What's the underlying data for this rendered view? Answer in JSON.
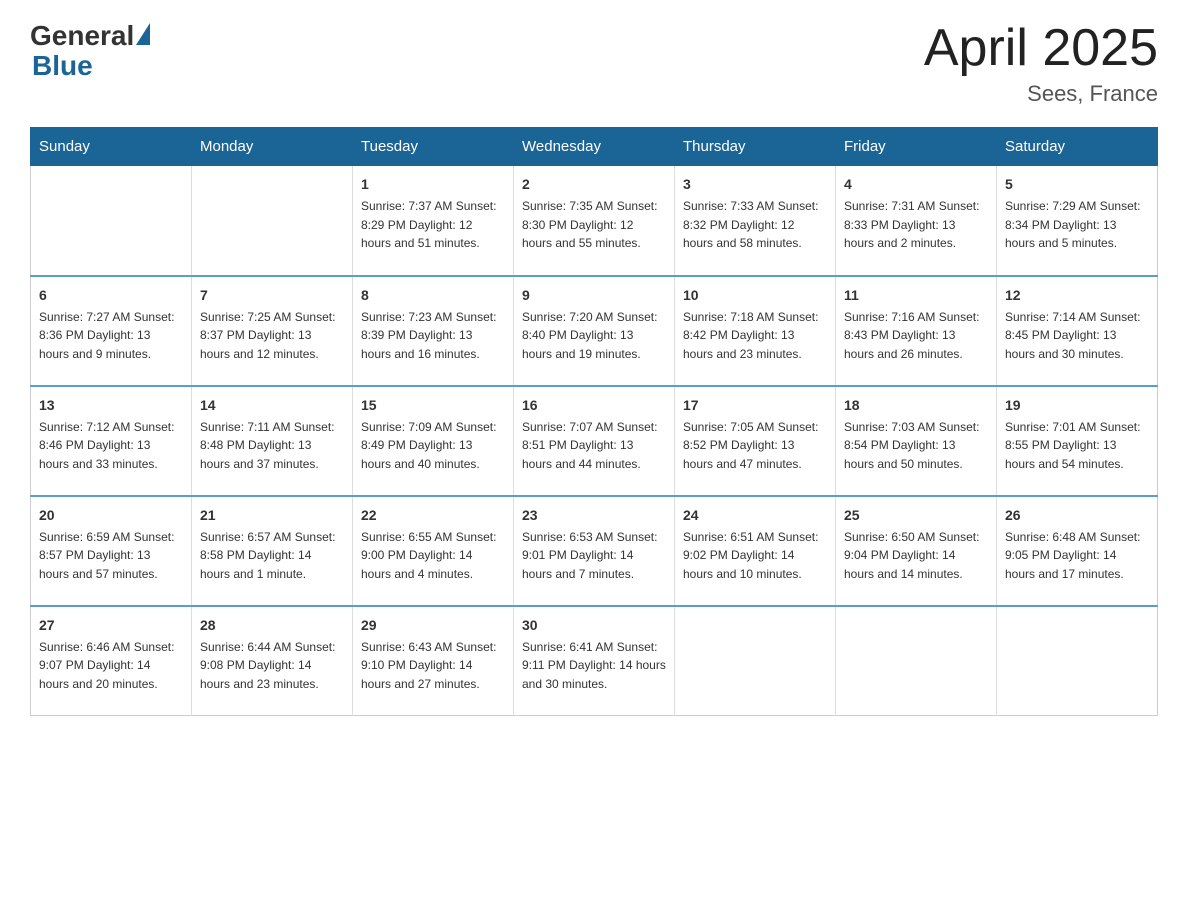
{
  "header": {
    "logo_general": "General",
    "logo_blue": "Blue",
    "month_year": "April 2025",
    "location": "Sees, France"
  },
  "days_of_week": [
    "Sunday",
    "Monday",
    "Tuesday",
    "Wednesday",
    "Thursday",
    "Friday",
    "Saturday"
  ],
  "weeks": [
    [
      {
        "day": "",
        "info": ""
      },
      {
        "day": "",
        "info": ""
      },
      {
        "day": "1",
        "info": "Sunrise: 7:37 AM\nSunset: 8:29 PM\nDaylight: 12 hours\nand 51 minutes."
      },
      {
        "day": "2",
        "info": "Sunrise: 7:35 AM\nSunset: 8:30 PM\nDaylight: 12 hours\nand 55 minutes."
      },
      {
        "day": "3",
        "info": "Sunrise: 7:33 AM\nSunset: 8:32 PM\nDaylight: 12 hours\nand 58 minutes."
      },
      {
        "day": "4",
        "info": "Sunrise: 7:31 AM\nSunset: 8:33 PM\nDaylight: 13 hours\nand 2 minutes."
      },
      {
        "day": "5",
        "info": "Sunrise: 7:29 AM\nSunset: 8:34 PM\nDaylight: 13 hours\nand 5 minutes."
      }
    ],
    [
      {
        "day": "6",
        "info": "Sunrise: 7:27 AM\nSunset: 8:36 PM\nDaylight: 13 hours\nand 9 minutes."
      },
      {
        "day": "7",
        "info": "Sunrise: 7:25 AM\nSunset: 8:37 PM\nDaylight: 13 hours\nand 12 minutes."
      },
      {
        "day": "8",
        "info": "Sunrise: 7:23 AM\nSunset: 8:39 PM\nDaylight: 13 hours\nand 16 minutes."
      },
      {
        "day": "9",
        "info": "Sunrise: 7:20 AM\nSunset: 8:40 PM\nDaylight: 13 hours\nand 19 minutes."
      },
      {
        "day": "10",
        "info": "Sunrise: 7:18 AM\nSunset: 8:42 PM\nDaylight: 13 hours\nand 23 minutes."
      },
      {
        "day": "11",
        "info": "Sunrise: 7:16 AM\nSunset: 8:43 PM\nDaylight: 13 hours\nand 26 minutes."
      },
      {
        "day": "12",
        "info": "Sunrise: 7:14 AM\nSunset: 8:45 PM\nDaylight: 13 hours\nand 30 minutes."
      }
    ],
    [
      {
        "day": "13",
        "info": "Sunrise: 7:12 AM\nSunset: 8:46 PM\nDaylight: 13 hours\nand 33 minutes."
      },
      {
        "day": "14",
        "info": "Sunrise: 7:11 AM\nSunset: 8:48 PM\nDaylight: 13 hours\nand 37 minutes."
      },
      {
        "day": "15",
        "info": "Sunrise: 7:09 AM\nSunset: 8:49 PM\nDaylight: 13 hours\nand 40 minutes."
      },
      {
        "day": "16",
        "info": "Sunrise: 7:07 AM\nSunset: 8:51 PM\nDaylight: 13 hours\nand 44 minutes."
      },
      {
        "day": "17",
        "info": "Sunrise: 7:05 AM\nSunset: 8:52 PM\nDaylight: 13 hours\nand 47 minutes."
      },
      {
        "day": "18",
        "info": "Sunrise: 7:03 AM\nSunset: 8:54 PM\nDaylight: 13 hours\nand 50 minutes."
      },
      {
        "day": "19",
        "info": "Sunrise: 7:01 AM\nSunset: 8:55 PM\nDaylight: 13 hours\nand 54 minutes."
      }
    ],
    [
      {
        "day": "20",
        "info": "Sunrise: 6:59 AM\nSunset: 8:57 PM\nDaylight: 13 hours\nand 57 minutes."
      },
      {
        "day": "21",
        "info": "Sunrise: 6:57 AM\nSunset: 8:58 PM\nDaylight: 14 hours\nand 1 minute."
      },
      {
        "day": "22",
        "info": "Sunrise: 6:55 AM\nSunset: 9:00 PM\nDaylight: 14 hours\nand 4 minutes."
      },
      {
        "day": "23",
        "info": "Sunrise: 6:53 AM\nSunset: 9:01 PM\nDaylight: 14 hours\nand 7 minutes."
      },
      {
        "day": "24",
        "info": "Sunrise: 6:51 AM\nSunset: 9:02 PM\nDaylight: 14 hours\nand 10 minutes."
      },
      {
        "day": "25",
        "info": "Sunrise: 6:50 AM\nSunset: 9:04 PM\nDaylight: 14 hours\nand 14 minutes."
      },
      {
        "day": "26",
        "info": "Sunrise: 6:48 AM\nSunset: 9:05 PM\nDaylight: 14 hours\nand 17 minutes."
      }
    ],
    [
      {
        "day": "27",
        "info": "Sunrise: 6:46 AM\nSunset: 9:07 PM\nDaylight: 14 hours\nand 20 minutes."
      },
      {
        "day": "28",
        "info": "Sunrise: 6:44 AM\nSunset: 9:08 PM\nDaylight: 14 hours\nand 23 minutes."
      },
      {
        "day": "29",
        "info": "Sunrise: 6:43 AM\nSunset: 9:10 PM\nDaylight: 14 hours\nand 27 minutes."
      },
      {
        "day": "30",
        "info": "Sunrise: 6:41 AM\nSunset: 9:11 PM\nDaylight: 14 hours\nand 30 minutes."
      },
      {
        "day": "",
        "info": ""
      },
      {
        "day": "",
        "info": ""
      },
      {
        "day": "",
        "info": ""
      }
    ]
  ]
}
